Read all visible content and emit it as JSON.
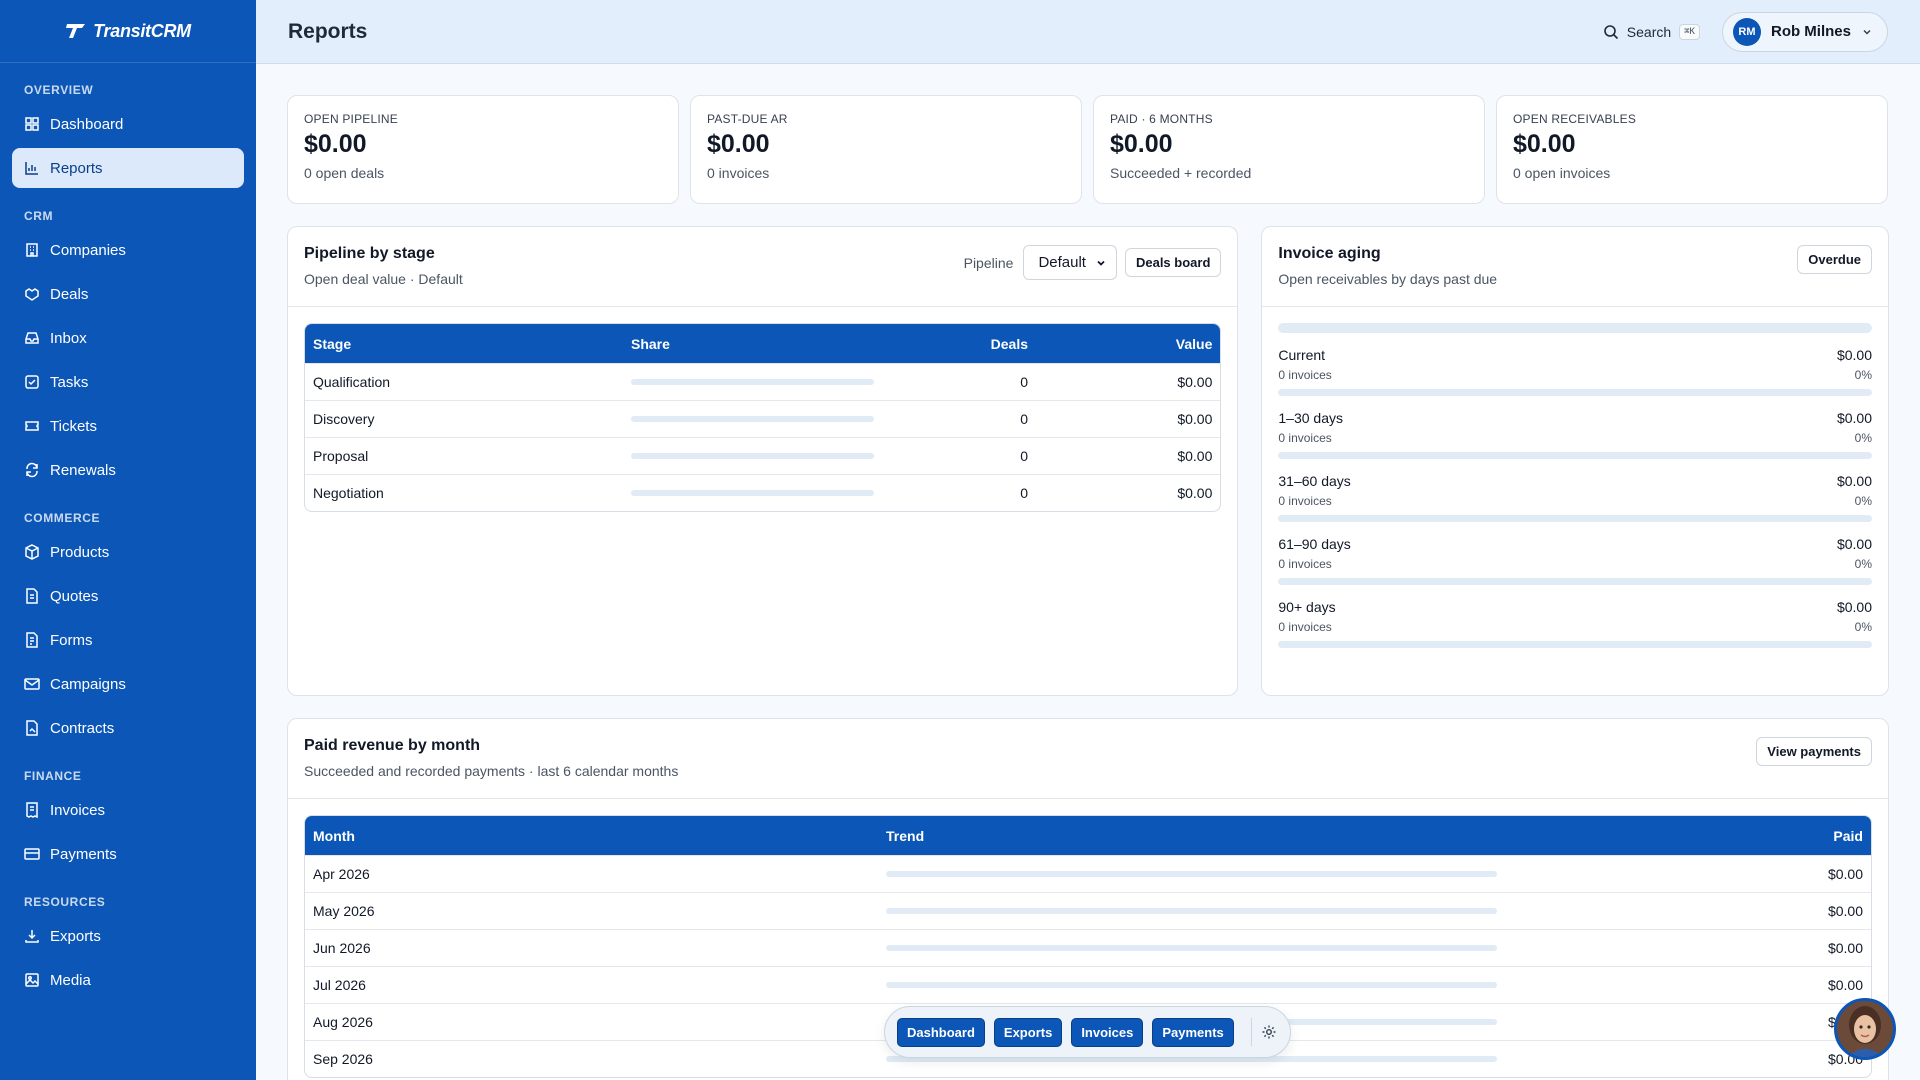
{
  "app": {
    "brand": "TransitCRM",
    "page_title": "Reports"
  },
  "header": {
    "search_label": "Search",
    "search_shortcut": "⌘K",
    "user_initials": "RM",
    "user_name": "Rob Milnes"
  },
  "sidebar": {
    "sections": [
      {
        "title": "OVERVIEW",
        "items": [
          {
            "label": "Dashboard",
            "icon": "grid-icon"
          },
          {
            "label": "Reports",
            "icon": "bar-chart-icon",
            "active": true
          }
        ]
      },
      {
        "title": "CRM",
        "items": [
          {
            "label": "Companies",
            "icon": "building-icon"
          },
          {
            "label": "Deals",
            "icon": "handshake-icon"
          },
          {
            "label": "Inbox",
            "icon": "inbox-icon"
          },
          {
            "label": "Tasks",
            "icon": "checkbox-icon"
          },
          {
            "label": "Tickets",
            "icon": "ticket-icon"
          },
          {
            "label": "Renewals",
            "icon": "refresh-icon"
          }
        ]
      },
      {
        "title": "COMMERCE",
        "items": [
          {
            "label": "Products",
            "icon": "box-icon"
          },
          {
            "label": "Quotes",
            "icon": "file-icon"
          },
          {
            "label": "Forms",
            "icon": "form-icon"
          },
          {
            "label": "Campaigns",
            "icon": "mail-icon"
          },
          {
            "label": "Contracts",
            "icon": "contract-icon"
          }
        ]
      },
      {
        "title": "FINANCE",
        "items": [
          {
            "label": "Invoices",
            "icon": "invoice-icon"
          },
          {
            "label": "Payments",
            "icon": "card-icon"
          }
        ]
      },
      {
        "title": "RESOURCES",
        "items": [
          {
            "label": "Exports",
            "icon": "download-icon"
          },
          {
            "label": "Media",
            "icon": "image-icon"
          }
        ]
      }
    ]
  },
  "kpis": [
    {
      "label": "OPEN PIPELINE",
      "value": "$0.00",
      "sub": "0 open deals"
    },
    {
      "label": "PAST-DUE AR",
      "value": "$0.00",
      "sub": "0 invoices"
    },
    {
      "label": "PAID · 6 MONTHS",
      "value": "$0.00",
      "sub": "Succeeded + recorded"
    },
    {
      "label": "OPEN RECEIVABLES",
      "value": "$0.00",
      "sub": "0 open invoices"
    }
  ],
  "pipeline": {
    "title": "Pipeline by stage",
    "subtitle": "Open deal value · Default",
    "select_label": "Pipeline",
    "select_value": "Default",
    "board_button": "Deals board",
    "columns": [
      "Stage",
      "Share",
      "Deals",
      "Value"
    ],
    "rows": [
      {
        "stage": "Qualification",
        "share": 0,
        "deals": "0",
        "value": "$0.00"
      },
      {
        "stage": "Discovery",
        "share": 0,
        "deals": "0",
        "value": "$0.00"
      },
      {
        "stage": "Proposal",
        "share": 0,
        "deals": "0",
        "value": "$0.00"
      },
      {
        "stage": "Negotiation",
        "share": 0,
        "deals": "0",
        "value": "$0.00"
      }
    ]
  },
  "aging": {
    "title": "Invoice aging",
    "subtitle": "Open receivables by days past due",
    "button": "Overdue",
    "buckets": [
      {
        "label": "Current",
        "value": "$0.00",
        "count": "0 invoices",
        "pct": "0%"
      },
      {
        "label": "1–30 days",
        "value": "$0.00",
        "count": "0 invoices",
        "pct": "0%"
      },
      {
        "label": "31–60 days",
        "value": "$0.00",
        "count": "0 invoices",
        "pct": "0%"
      },
      {
        "label": "61–90 days",
        "value": "$0.00",
        "count": "0 invoices",
        "pct": "0%"
      },
      {
        "label": "90+ days",
        "value": "$0.00",
        "count": "0 invoices",
        "pct": "0%"
      }
    ]
  },
  "revenue": {
    "title": "Paid revenue by month",
    "subtitle": "Succeeded and recorded payments · last 6 calendar months",
    "button": "View payments",
    "columns": [
      "Month",
      "Trend",
      "Paid"
    ],
    "rows": [
      {
        "month": "Apr 2026",
        "trend": 0,
        "paid": "$0.00"
      },
      {
        "month": "May 2026",
        "trend": 0,
        "paid": "$0.00"
      },
      {
        "month": "Jun 2026",
        "trend": 0,
        "paid": "$0.00"
      },
      {
        "month": "Jul 2026",
        "trend": 0,
        "paid": "$0.00"
      },
      {
        "month": "Aug 2026",
        "trend": 0,
        "paid": "$0.00"
      },
      {
        "month": "Sep 2026",
        "trend": 0,
        "paid": "$0.00"
      }
    ]
  },
  "floatbar": {
    "chips": [
      "Dashboard",
      "Exports",
      "Invoices",
      "Payments"
    ],
    "settings_icon": "gear-icon"
  },
  "colors": {
    "primary": "#0b56b6",
    "active_nav_bg": "#dbe9fb",
    "header_bg": "#e2eefb",
    "bar_track": "#e1ebf6"
  }
}
